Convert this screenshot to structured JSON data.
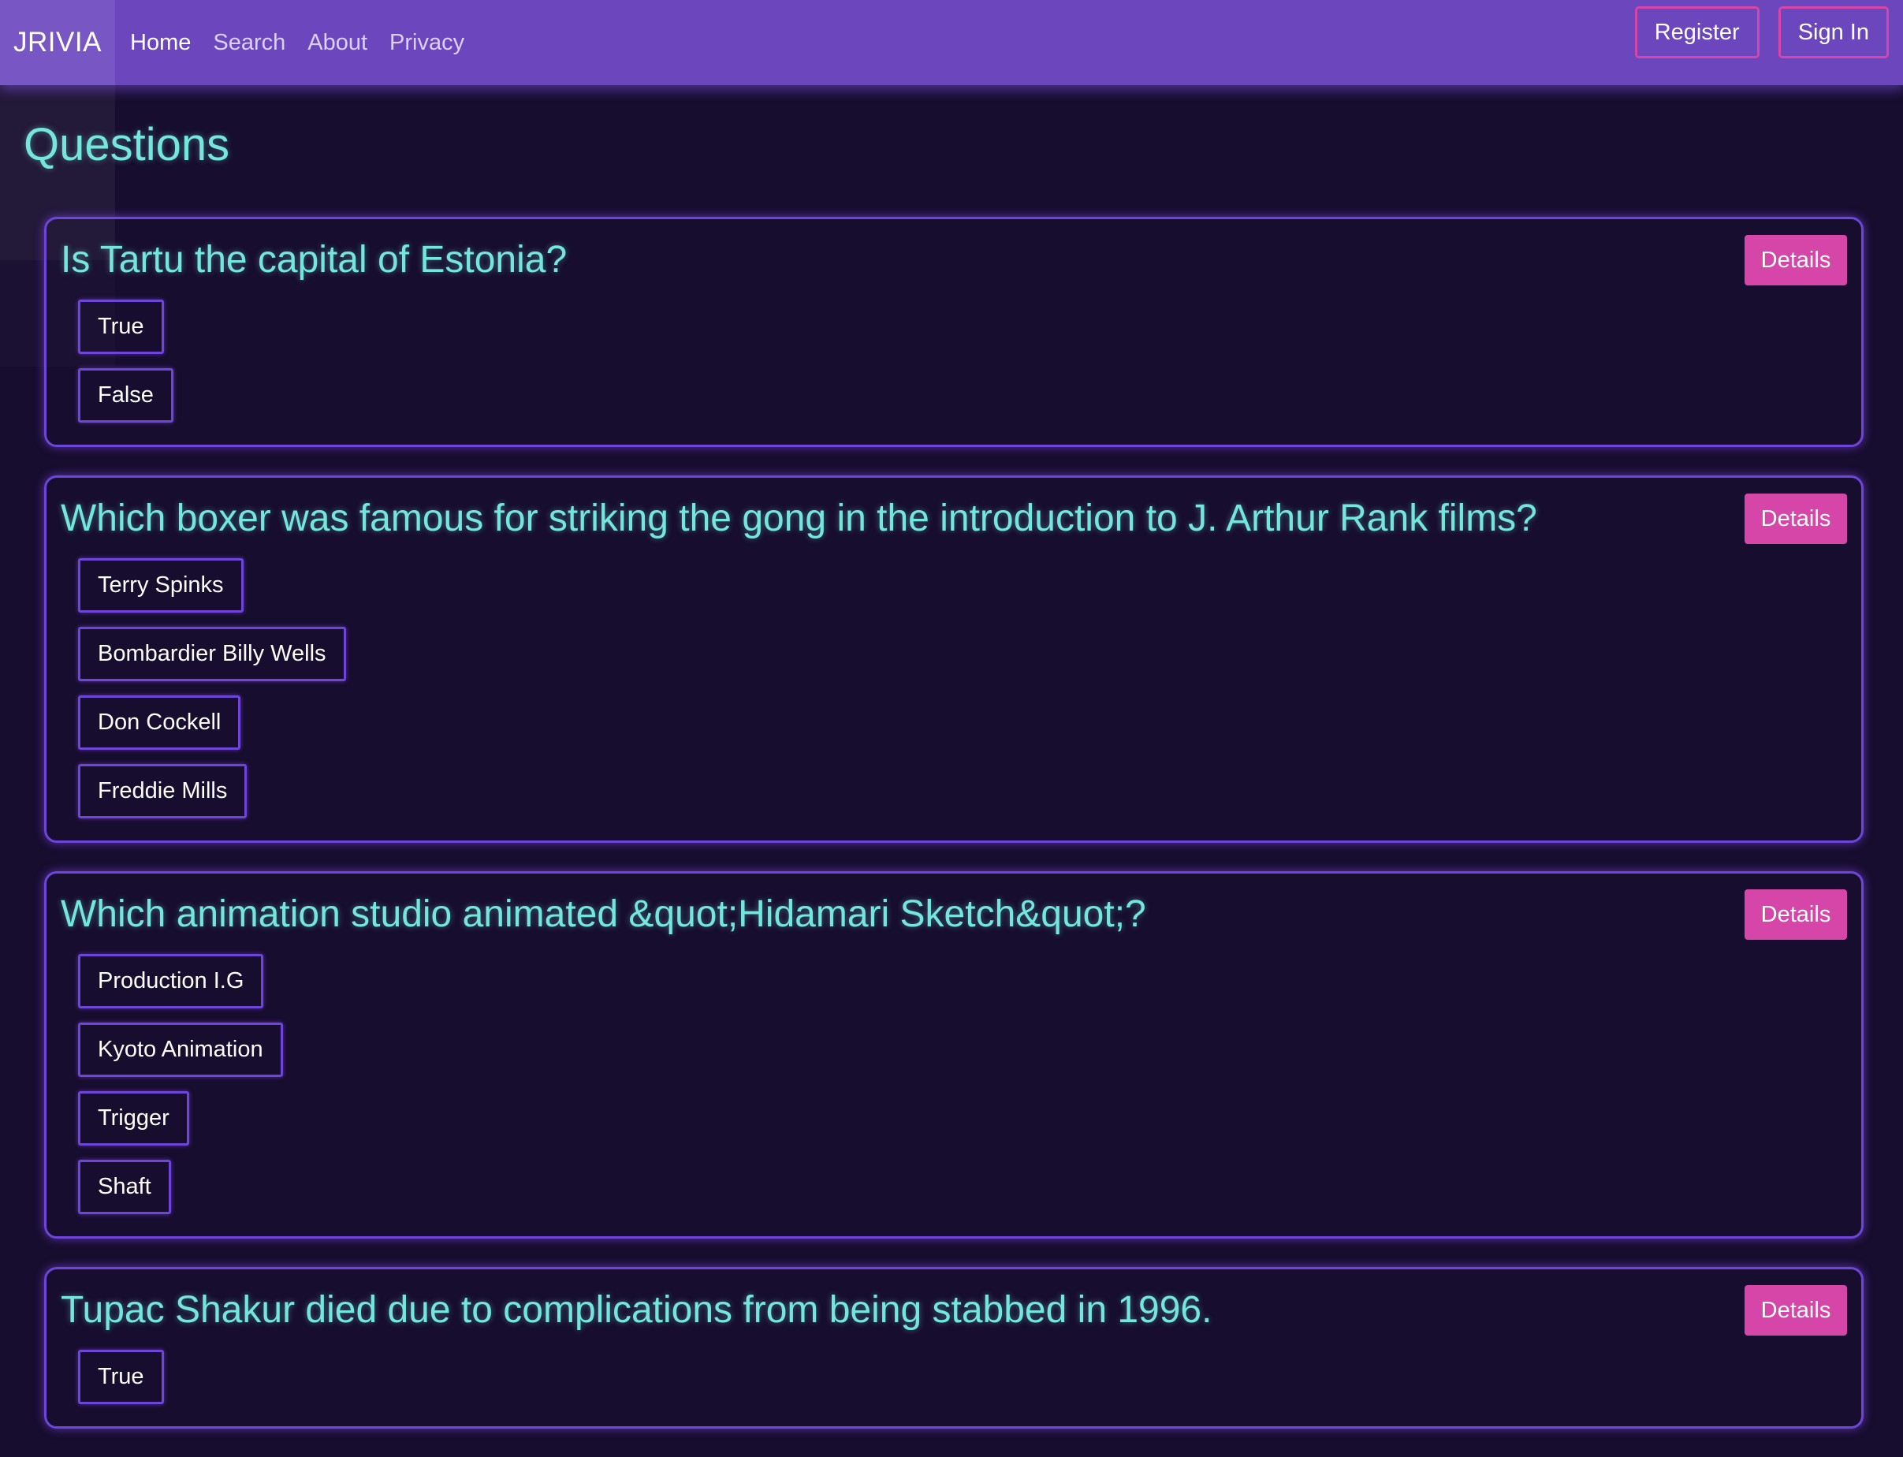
{
  "navbar": {
    "brand": "JRIVIA",
    "links": [
      {
        "label": "Home",
        "active": true
      },
      {
        "label": "Search",
        "active": false
      },
      {
        "label": "About",
        "active": false
      },
      {
        "label": "Privacy",
        "active": false
      }
    ],
    "register_label": "Register",
    "signin_label": "Sign In"
  },
  "page": {
    "title": "Questions"
  },
  "details_label": "Details",
  "questions": [
    {
      "text": "Is Tartu the capital of Estonia?",
      "answers": [
        "True",
        "False"
      ]
    },
    {
      "text": "Which boxer was famous for striking the gong in the introduction to J. Arthur Rank films?",
      "answers": [
        "Terry Spinks",
        "Bombardier Billy Wells",
        "Don Cockell",
        "Freddie Mills"
      ]
    },
    {
      "text": "Which animation studio animated &quot;Hidamari Sketch&quot;?",
      "answers": [
        "Production I.G",
        "Kyoto Animation",
        "Trigger",
        "Shaft"
      ]
    },
    {
      "text": "Tupac Shakur died due to complications from being stabbed in 1996.",
      "answers": [
        "True"
      ]
    }
  ],
  "colors": {
    "background": "#170d2e",
    "navbar": "#6b46bd",
    "accent_pink": "#d645a8",
    "accent_teal": "#74e6dc",
    "border_purple": "#6f44d8"
  }
}
